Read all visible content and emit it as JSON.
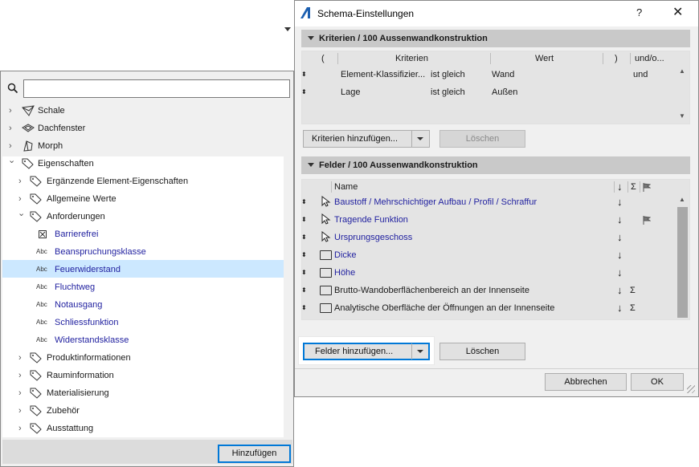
{
  "dialog": {
    "title": "Schema-Einstellungen",
    "help": "?",
    "close": "✕",
    "criteria_header": "Kriterien / 100 Aussenwandkonstruktion",
    "criteria_columns": {
      "open": "(",
      "criteria": "Kriterien",
      "value": "Wert",
      "close": ")",
      "andor": "und/o..."
    },
    "criteria_rows": [
      {
        "criterion": "Element-Klassifizier...",
        "op": "ist gleich",
        "value": "Wand",
        "andor": "und"
      },
      {
        "criterion": "Lage",
        "op": "ist gleich",
        "value": "Außen",
        "andor": ""
      }
    ],
    "add_criteria": "Kriterien hinzufügen...",
    "delete_criteria": "Löschen",
    "fields_header": "Felder / 100 Aussenwandkonstruktion",
    "fields_columns": {
      "name": "Name",
      "sort": "↓",
      "sum": "Σ"
    },
    "fields_rows": [
      {
        "name": "Baustoff / Mehrschichtiger Aufbau / Profil / Schraffur",
        "sort": "↓",
        "sum": "",
        "flag": false
      },
      {
        "name": "Tragende Funktion",
        "sort": "↓",
        "sum": "",
        "flag": true
      },
      {
        "name": "Ursprungsgeschoss",
        "sort": "↓",
        "sum": "",
        "flag": false
      },
      {
        "name": "Dicke",
        "sort": "↓",
        "sum": "",
        "flag": false
      },
      {
        "name": "Höhe",
        "sort": "↓",
        "sum": "",
        "flag": false
      },
      {
        "name": "Brutto-Wandoberflächenbereich an der Innenseite",
        "sort": "↓",
        "sum": "Σ",
        "flag": false
      },
      {
        "name": "Analytische Oberfläche der Öffnungen an der Innenseite",
        "sort": "↓",
        "sum": "Σ",
        "flag": false
      }
    ],
    "add_fields": "Felder hinzufügen...",
    "delete_fields": "Löschen",
    "cancel": "Abbrechen",
    "ok": "OK"
  },
  "left_panel": {
    "search_placeholder": "",
    "items": [
      {
        "label": "Schale",
        "level": 0,
        "chev": "›"
      },
      {
        "label": "Dachfenster",
        "level": 0,
        "chev": "›"
      },
      {
        "label": "Morph",
        "level": 0,
        "chev": "›"
      },
      {
        "label": "Eigenschaften",
        "level": 0,
        "chev": "⌄"
      },
      {
        "label": "Ergänzende Element-Eigenschaften",
        "level": 1,
        "chev": "›"
      },
      {
        "label": "Allgemeine Werte",
        "level": 1,
        "chev": "›"
      },
      {
        "label": "Anforderungen",
        "level": 1,
        "chev": "⌄"
      },
      {
        "label": "Barrierefrei",
        "level": 2
      },
      {
        "label": "Beanspruchungsklasse",
        "level": 2
      },
      {
        "label": "Feuerwiderstand",
        "level": 2
      },
      {
        "label": "Fluchtweg",
        "level": 2
      },
      {
        "label": "Notausgang",
        "level": 2
      },
      {
        "label": "Schliessfunktion",
        "level": 2
      },
      {
        "label": "Widerstandsklasse",
        "level": 2
      },
      {
        "label": "Produktinformationen",
        "level": 1,
        "chev": "›"
      },
      {
        "label": "Rauminformation",
        "level": 1,
        "chev": "›"
      },
      {
        "label": "Materialisierung",
        "level": 1,
        "chev": "›"
      },
      {
        "label": "Zubehör",
        "level": 1,
        "chev": "›"
      },
      {
        "label": "Ausstattung",
        "level": 1,
        "chev": "›"
      }
    ],
    "abc": "Abc",
    "add_button": "Hinzufügen"
  },
  "colors": {
    "link_blue": "#1f1f9f",
    "selection": "#cce8ff",
    "focus": "#0078d7"
  }
}
